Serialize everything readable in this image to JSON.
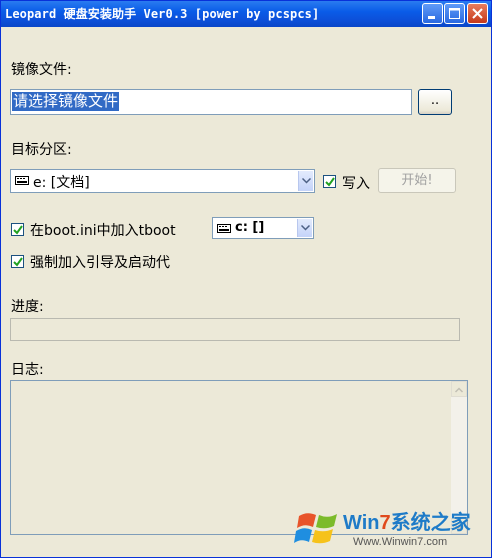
{
  "window": {
    "title": "Leopard 硬盘安装助手 Ver0.3 [power by pcspcs]"
  },
  "image_section": {
    "label": "镜像文件:",
    "field_value": "请选择镜像文件",
    "browse_label": ".."
  },
  "partition_section": {
    "label": "目标分区:",
    "selected": "e: [文档]",
    "write_label": "写入",
    "write_checked": true,
    "start_label": "开始!"
  },
  "boot_options": {
    "tboot_label": "在boot.ini中加入tboot",
    "tboot_checked": true,
    "tboot_drive": "c: []",
    "force_label": "强制加入引导及启动代",
    "force_checked": true
  },
  "progress": {
    "label": "进度:",
    "value": 0
  },
  "log": {
    "label": "日志:"
  },
  "watermark": {
    "brand_prefix": "Win",
    "brand_num": "7",
    "brand_suffix": "系统之家",
    "url": "Www.Winwin7.com"
  }
}
